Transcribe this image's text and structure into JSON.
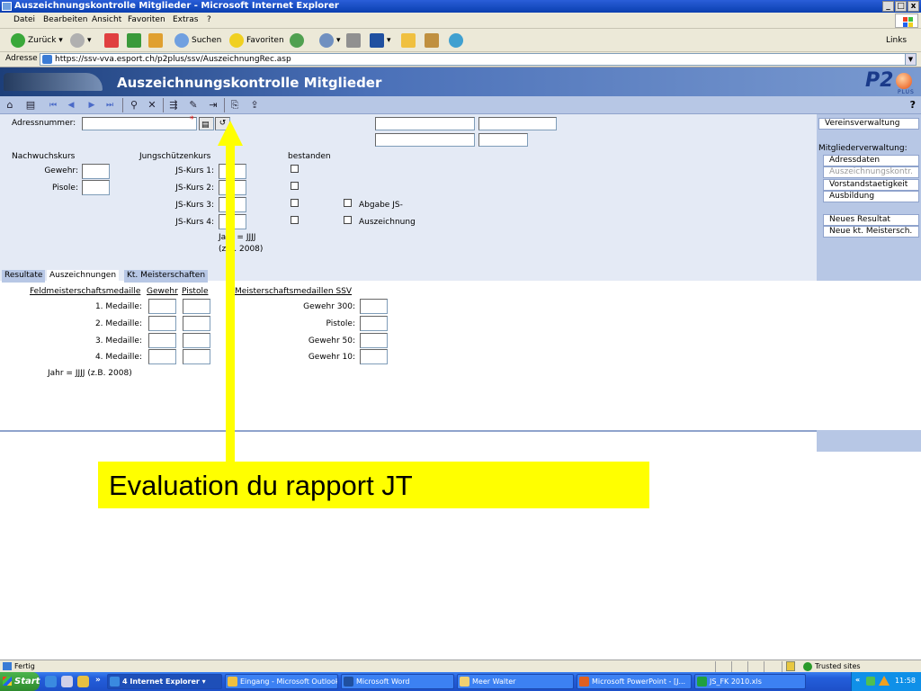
{
  "window": {
    "title": "Auszeichnungskontrolle Mitglieder - Microsoft Internet Explorer",
    "controls": {
      "minimize": "_",
      "maximize": "□",
      "close": "x"
    }
  },
  "menu": [
    "Datei",
    "Bearbeiten",
    "Ansicht",
    "Favoriten",
    "Extras",
    "?"
  ],
  "toolbar": {
    "back": "Zurück",
    "search": "Suchen",
    "favorites": "Favoriten",
    "links": "Links"
  },
  "address": {
    "label": "Adresse",
    "url": "https://ssv-vva.esport.ch/p2plus/ssv/AuszeichnungRec.asp"
  },
  "app": {
    "title": "Auszeichnungskontrolle Mitglieder",
    "logo_text": "P2",
    "logo_sub": "PLUS",
    "help": "?"
  },
  "form": {
    "adressnummer_label": "Adressnummer:",
    "required_mark": "*",
    "nachwuchskurs": "Nachwuchskurs",
    "gewehr": "Gewehr:",
    "pistole": "Pisole:",
    "jungschuetzenkurs": "Jungschützenkurs",
    "js1": "JS-Kurs 1:",
    "js2": "JS-Kurs 2:",
    "js3": "JS-Kurs 3:",
    "js4": "JS-Kurs 4:",
    "bestanden": "bestanden",
    "abgabe": "Abgabe JS-",
    "auszeichnung": "Auszeichnung",
    "jahr_hint_1": "Jahr = JJJJ",
    "jahr_hint_2": "(z.B. 2008)"
  },
  "sidebar": {
    "vereinsverwaltung": "Vereinsverwaltung",
    "mitgliederverwaltung": "Mitgliederverwaltung:",
    "items": [
      "Adressdaten",
      "Auszeichnungskontr.",
      "Vorstandstaetigkeit",
      "Ausbildung"
    ],
    "neues_resultat": "Neues Resultat",
    "neue_meisterschaft": "Neue kt. Meistersch."
  },
  "tabs": [
    "Resultate",
    "Auszeichnungen",
    "Kt. Meisterschaften"
  ],
  "medals": {
    "feld_header": "Feldmeisterschaftsmedaille",
    "gewehr_header": "Gewehr",
    "pistole_header": "Pistole",
    "ssv_header": "Meisterschaftsmedaillen SSV",
    "rows": [
      "1. Medaille:",
      "2. Medaille:",
      "3. Medaille:",
      "4. Medaille:"
    ],
    "ssv_rows": [
      "Gewehr 300:",
      "Pistole:",
      "Gewehr 50:",
      "Gewehr 10:"
    ],
    "jahr_hint": "Jahr = JJJJ (z.B. 2008)"
  },
  "callout": "Evaluation du rapport JT",
  "overlay_color": "#ffff00",
  "status": {
    "text": "Fertig",
    "zone": "Trusted sites"
  },
  "taskbar": {
    "start": "Start",
    "tasks": [
      "4 Internet Explorer",
      "Eingang - Microsoft Outlook",
      "Microsoft Word",
      "Meer Walter",
      "Microsoft PowerPoint - [J...",
      "JS_FK 2010.xls"
    ],
    "clock": "11:58",
    "tray_chevron": "«"
  }
}
